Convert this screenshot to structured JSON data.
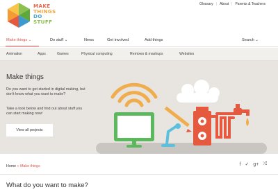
{
  "colors": {
    "accent": "#d9534f",
    "logo_make": "#e8684a",
    "logo_things": "#f0a742",
    "logo_do": "#4aa3c8",
    "logo_stuff": "#8bc34a",
    "hero_bg": "#e8e5e0",
    "subnav_bg": "#f2f0ec"
  },
  "logo": {
    "line1": "MAKE",
    "line2": "THINGS",
    "line3": "DO",
    "line4": "STUFF"
  },
  "utility_nav": {
    "items": [
      "Glossary",
      "About",
      "Parents & Teachers"
    ]
  },
  "main_nav": {
    "make_things": "Make things",
    "do_stuff": "Do stuff",
    "news": "News",
    "get_involved": "Get involved",
    "add_things": "Add things",
    "search": "Search"
  },
  "sub_nav": {
    "items": [
      "Animation",
      "Apps",
      "Games",
      "Physical computing",
      "Remixes & mashups",
      "Websites"
    ]
  },
  "hero": {
    "title": "Make things",
    "paragraph1": "Do you want to get started in digital making, but don't know what you want to make?",
    "paragraph2": "Take a look below and find out about stuff you can start making now!",
    "button": "View all projects"
  },
  "breadcrumb": {
    "home": "Home",
    "separator": "»",
    "current": "Make things"
  },
  "social": {
    "facebook": "f",
    "twitter": "✓",
    "googleplus": "g+",
    "share": "⤮"
  },
  "section": {
    "title": "What do you want to make?"
  }
}
